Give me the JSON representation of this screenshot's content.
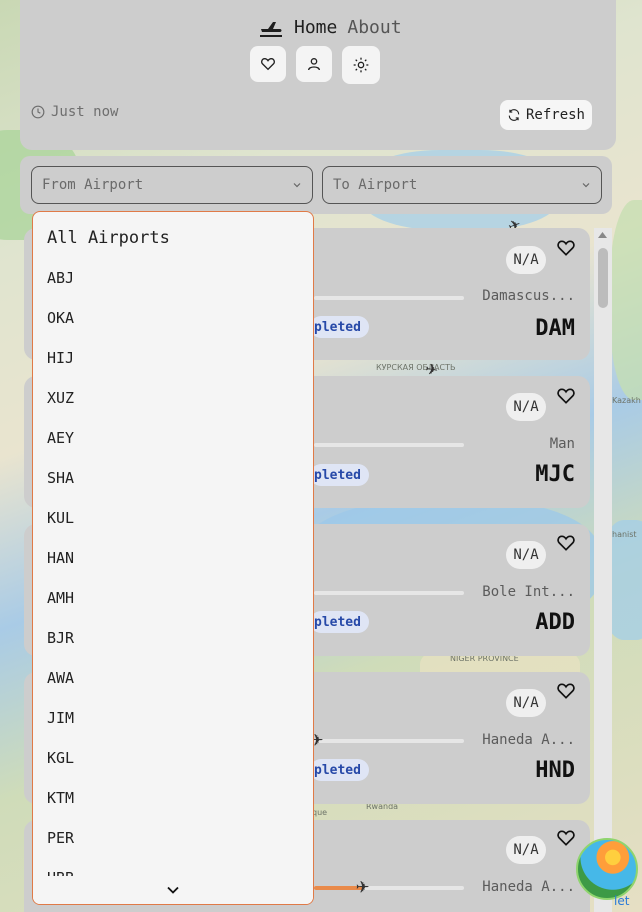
{
  "nav": {
    "home_label": "Home",
    "about_label": "About"
  },
  "header": {
    "updated_text": "Just now",
    "refresh_label": "Refresh"
  },
  "filters": {
    "from_placeholder": "From Airport",
    "to_placeholder": "To Airport"
  },
  "dropdown": {
    "options": [
      "All Airports",
      "ABJ",
      "OKA",
      "HIJ",
      "XUZ",
      "AEY",
      "SHA",
      "KUL",
      "HAN",
      "AMH",
      "BJR",
      "AWA",
      "JIM",
      "KGL",
      "KTM",
      "PER",
      "HBB"
    ]
  },
  "flights": [
    {
      "status_badge": "N/A",
      "dest_name": "Damascus...",
      "dest_code": "DAM",
      "status": "pleted"
    },
    {
      "status_badge": "N/A",
      "dest_name": "Man",
      "dest_code": "MJC",
      "status": "pleted"
    },
    {
      "status_badge": "N/A",
      "dest_name": "Bole Int...",
      "dest_code": "ADD",
      "status": "pleted"
    },
    {
      "status_badge": "N/A",
      "dest_name": "Haneda A...",
      "dest_code": "HND",
      "status": "pleted"
    },
    {
      "status_badge": "N/A",
      "dest_name": "Haneda A...",
      "dest_code": "",
      "status": ""
    }
  ],
  "map": {
    "labels": [
      "КУРСКАЯ ОБЛАСТЬ",
      "Kazakh",
      "Rwanda",
      "hanist",
      "que",
      "NIGER PROVINCE"
    ],
    "attribution": "let"
  },
  "colors": {
    "panel": "#cdcdcd",
    "accent_border": "#e07a47",
    "pill_bg": "#dfe5f5",
    "pill_text": "#2749a8"
  }
}
